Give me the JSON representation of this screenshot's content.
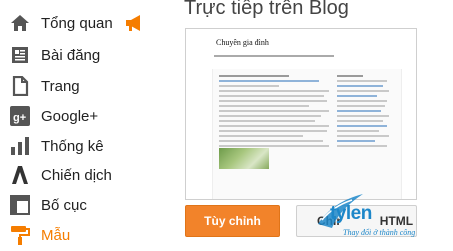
{
  "sidebar": {
    "items": [
      {
        "label": "Tổng quan",
        "icon": "home-icon"
      },
      {
        "label": "Bài đăng",
        "icon": "posts-icon"
      },
      {
        "label": "Trang",
        "icon": "pages-icon"
      },
      {
        "label": "Google+",
        "icon": "google-plus-icon"
      },
      {
        "label": "Thống kê",
        "icon": "stats-icon"
      },
      {
        "label": "Chiến dịch",
        "icon": "campaign-icon"
      },
      {
        "label": "Bố cục",
        "icon": "layout-icon"
      },
      {
        "label": "Mẫu",
        "icon": "paint-roller-icon"
      }
    ],
    "active_index": 7,
    "overview_badge_icon": "megaphone-icon"
  },
  "main": {
    "title": "Trực tiếp trên Blog",
    "preview": {
      "blog_title": "Chuyên gia đình"
    },
    "customize_button": "Tùy chỉnh",
    "edit_html_button": "Chỉnh sửa HTML"
  },
  "watermark": {
    "name": "tylen",
    "tagline": "Thay đổi ở thành công"
  },
  "colors": {
    "accent": "#f57d00",
    "button": "#f2832a",
    "watermark": "#1d87c9"
  }
}
